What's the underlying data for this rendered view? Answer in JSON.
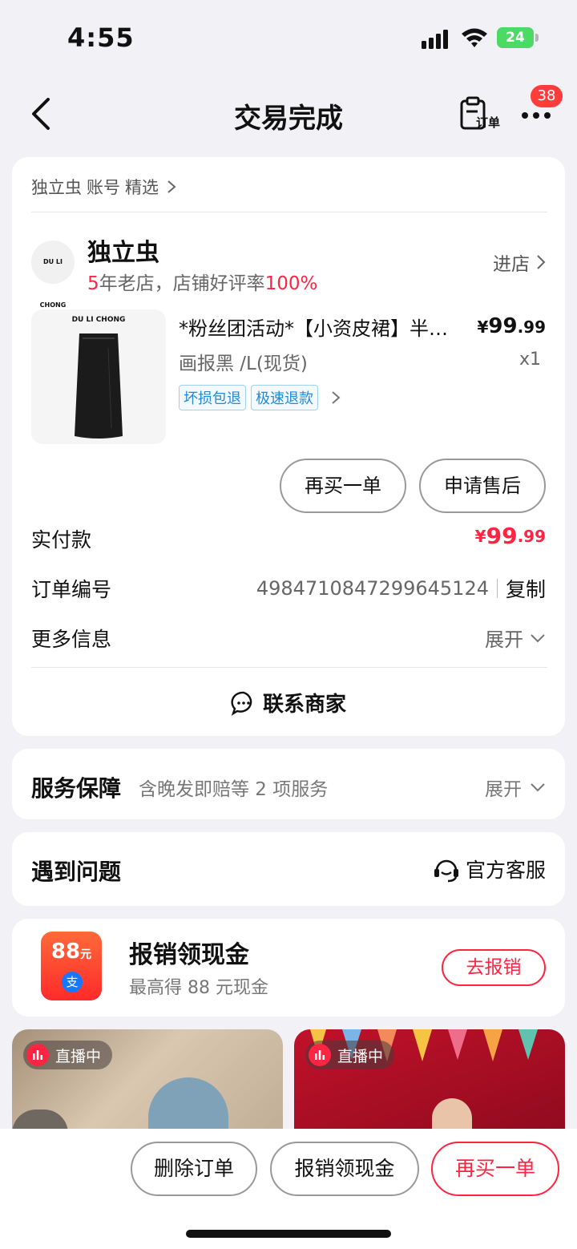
{
  "status_bar": {
    "time": "4:55",
    "battery": "24"
  },
  "nav": {
    "title": "交易完成",
    "order_label": "订单",
    "badge": "38"
  },
  "breadcrumb": {
    "items": [
      "独立虫",
      "账号",
      "精选"
    ]
  },
  "shop": {
    "logo_text": "DU LI CHONG",
    "name": "独立虫",
    "years": "5",
    "years_suffix": "年老店，店铺好评率",
    "rating": "100%",
    "enter_label": "进店"
  },
  "product": {
    "brand_text": "DU LI CHONG",
    "title": "*粉丝团活动*【小资皮裙】半身裙",
    "spec": "画报黑 /L(现货)",
    "price_symbol": "¥",
    "price_int": "99",
    "price_dec": ".99",
    "qty": "x1",
    "tags": [
      "坏损包退",
      "极速退款"
    ]
  },
  "actions": {
    "rebuy": "再买一单",
    "after_sale": "申请售后"
  },
  "details": {
    "paid_label": "实付款",
    "paid_symbol": "¥",
    "paid_int": "99",
    "paid_dec": ".99",
    "order_no_label": "订单编号",
    "order_no": "4984710847299645124",
    "copy_label": "复制",
    "more_label": "更多信息",
    "expand_label": "展开"
  },
  "contact": {
    "label": "联系商家"
  },
  "service": {
    "title": "服务保障",
    "desc": "含晚发即赔等 2 项服务",
    "expand": "展开"
  },
  "problem": {
    "title": "遇到问题",
    "cs_label": "官方客服"
  },
  "cashback": {
    "icon_amount": "88",
    "icon_unit": "元",
    "icon_alipay": "支",
    "title": "报销领现金",
    "sub": "最高得 88 元现金",
    "button": "去报销"
  },
  "live": [
    {
      "badge": "直播中"
    },
    {
      "badge": "直播中"
    }
  ],
  "bottom_bar": {
    "delete": "删除订单",
    "cashback": "报销领现金",
    "rebuy": "再买一单"
  },
  "colors": {
    "accent": "#ff2442",
    "tag_blue": "#1f8ad6",
    "background": "#f2f2f6"
  }
}
